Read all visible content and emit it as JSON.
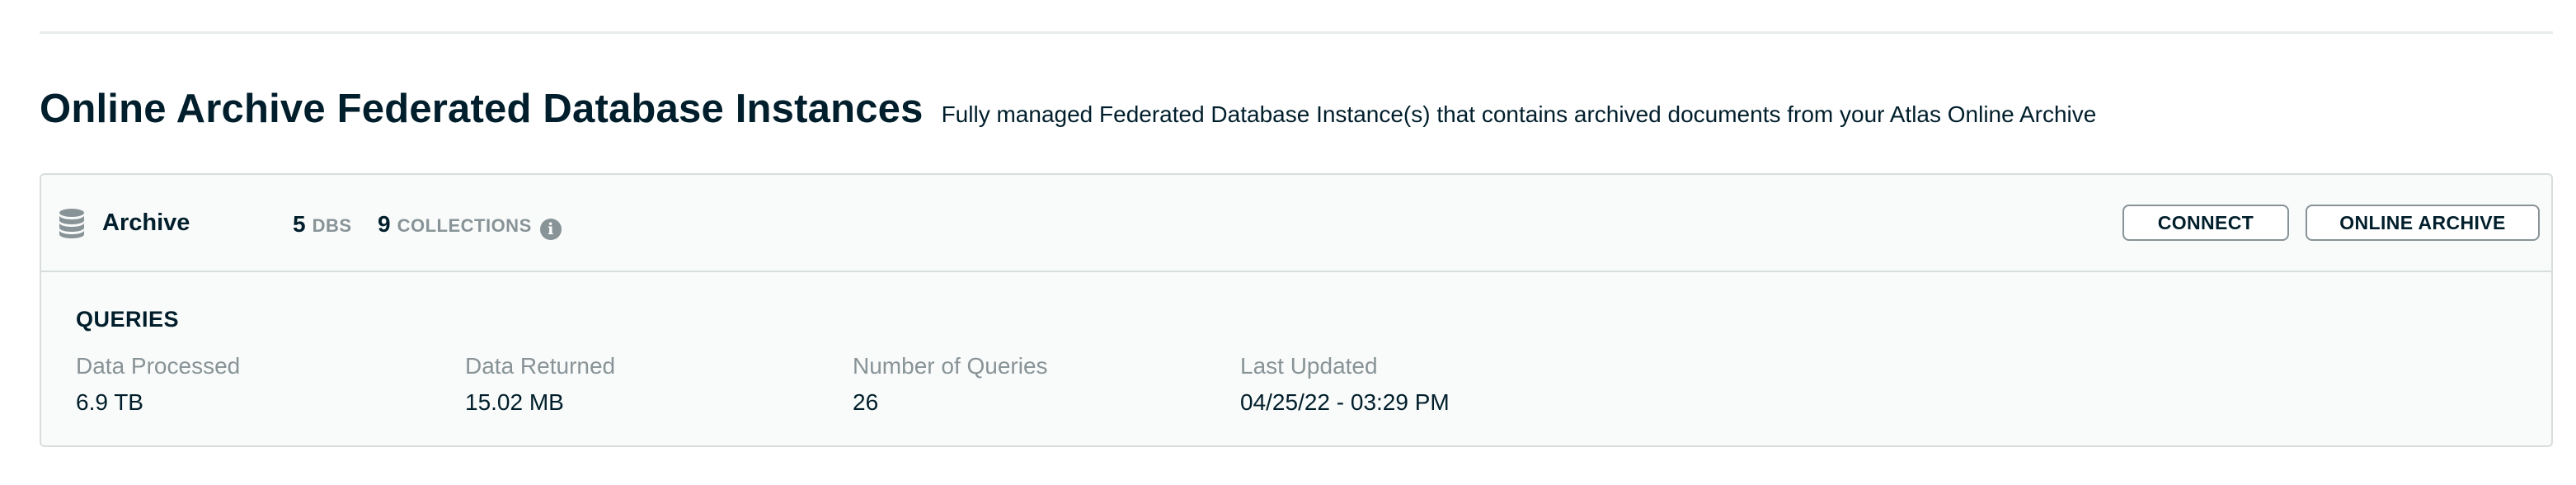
{
  "header": {
    "title": "Online Archive Federated Database Instances",
    "subtitle": "Fully managed Federated Database Instance(s) that contains archived documents from your Atlas Online Archive"
  },
  "instance": {
    "icon": "database-icon",
    "name": "Archive",
    "dbs_count": "5",
    "dbs_label": "DBS",
    "collections_count": "9",
    "collections_label": "COLLECTIONS",
    "info_glyph": "i",
    "connect_label": "CONNECT",
    "online_archive_label": "ONLINE ARCHIVE"
  },
  "queries": {
    "title": "QUERIES",
    "metrics": [
      {
        "label": "Data Processed",
        "value": "6.9 TB"
      },
      {
        "label": "Data Returned",
        "value": "15.02 MB"
      },
      {
        "label": "Number of Queries",
        "value": "26"
      },
      {
        "label": "Last Updated",
        "value": "04/25/22 - 03:29 PM"
      }
    ]
  },
  "colors": {
    "text_primary": "#001e2b",
    "text_muted": "#889397",
    "border": "#d8dedc",
    "card_bg": "#f9fbfa"
  }
}
